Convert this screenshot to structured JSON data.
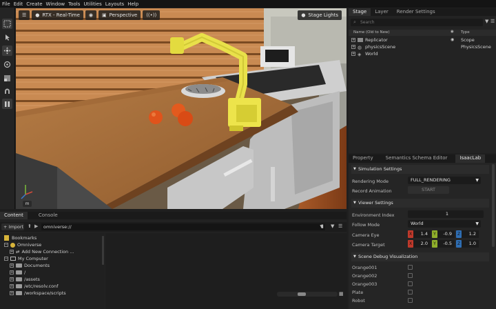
{
  "menubar": [
    "File",
    "Edit",
    "Create",
    "Window",
    "Tools",
    "Utilities",
    "Layouts",
    "Help"
  ],
  "viewport": {
    "renderer": "RTX - Real-Time",
    "camera": "Perspective",
    "stage_lights": "Stage Lights",
    "axis_label": "m"
  },
  "stage": {
    "tabs": [
      "Stage",
      "Layer",
      "Render Settings"
    ],
    "search_placeholder": "Search",
    "col_name": "Name (Old to New)",
    "col_type": "Type",
    "items": [
      {
        "name": "Replicator",
        "type": "Scope"
      },
      {
        "name": "physicsScene",
        "type": "PhysicsScene"
      },
      {
        "name": "World",
        "type": ""
      }
    ]
  },
  "property": {
    "tabs": [
      "Property",
      "Semantics Schema Editor",
      "IsaacLab"
    ],
    "sim_settings": "Simulation Settings",
    "rendering_mode_label": "Rendering Mode",
    "rendering_mode_value": "FULL_RENDERING",
    "record_anim_label": "Record Animation",
    "record_anim_button": "START",
    "viewer_settings": "Viewer Settings",
    "env_index_label": "Environment Index",
    "env_index_value": "1",
    "follow_mode_label": "Follow Mode",
    "follow_mode_value": "World",
    "camera_eye_label": "Camera Eye",
    "camera_eye": [
      "1.4",
      "-0.9",
      "1.2"
    ],
    "camera_target_label": "Camera Target",
    "camera_target": [
      "2.0",
      "-0.5",
      "1.0"
    ],
    "debug_vis": "Scene Debug Visualization",
    "debug_items": [
      "Orange001",
      "Orange002",
      "Orange003",
      "Plate",
      "Robot"
    ]
  },
  "content": {
    "tabs": [
      "Content",
      "Console"
    ],
    "import_label": "Import",
    "path": "omniverse://",
    "tree": [
      {
        "label": "Bookmarks",
        "level": 0,
        "kind": "bookmark"
      },
      {
        "label": "Omniverse",
        "level": 0,
        "kind": "omni"
      },
      {
        "label": "Add New Connection ...",
        "level": 1,
        "kind": "add"
      },
      {
        "label": "My Computer",
        "level": 0,
        "kind": "computer"
      },
      {
        "label": "Documents",
        "level": 1,
        "kind": "folder"
      },
      {
        "label": "/",
        "level": 1,
        "kind": "folder"
      },
      {
        "label": "/assets",
        "level": 1,
        "kind": "folder"
      },
      {
        "label": "/etc/resolv.conf",
        "level": 1,
        "kind": "folder"
      },
      {
        "label": "/workspace/scripts",
        "level": 1,
        "kind": "folder"
      }
    ]
  },
  "colors": {
    "accent": "#76b900",
    "x_axis": "#c0392b",
    "y_axis": "#8fae2b",
    "z_axis": "#2f6fb5"
  }
}
